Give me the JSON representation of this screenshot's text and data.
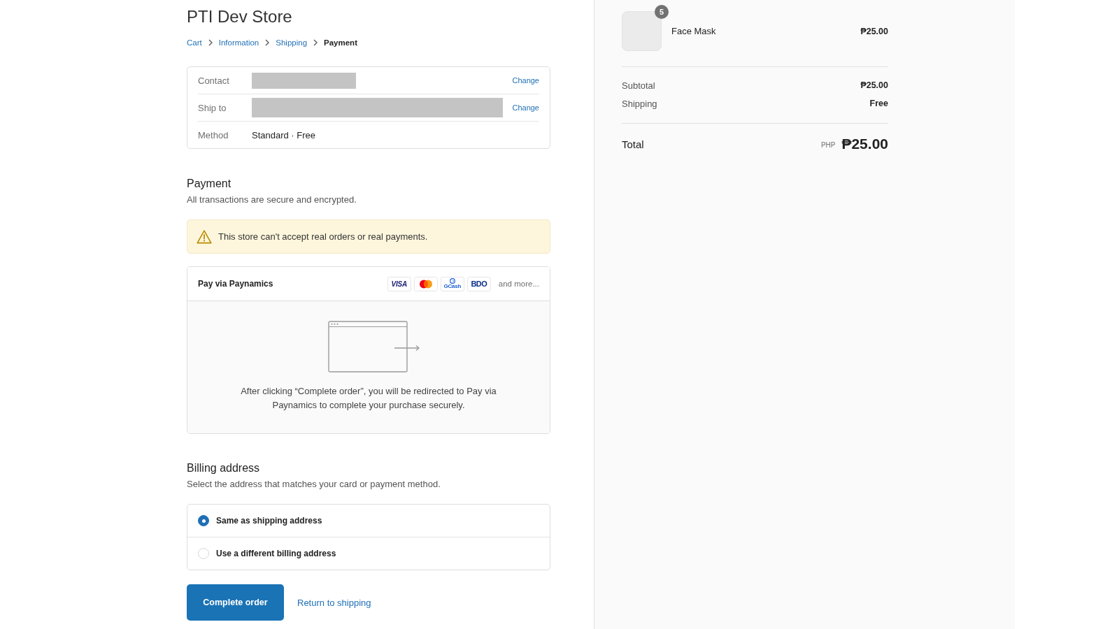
{
  "store": {
    "title": "PTI Dev Store"
  },
  "breadcrumb": [
    {
      "label": "Cart",
      "selected": false
    },
    {
      "label": "Information",
      "selected": false
    },
    {
      "label": "Shipping",
      "selected": false
    },
    {
      "label": "Payment",
      "selected": true
    }
  ],
  "review": [
    {
      "label": "Contact",
      "kind": "redacted",
      "action": "Change"
    },
    {
      "label": "Ship to",
      "kind": "redacted",
      "action": "Change"
    },
    {
      "label": "Method",
      "kind": "text",
      "value": "Standard · Free"
    }
  ],
  "payment": {
    "title": "Payment",
    "subtitle": "All transactions are secure and encrypted.",
    "warning": "This store can't accept real orders or real payments.",
    "method": {
      "title": "Pay via Paynamics",
      "logos": [
        {
          "kind": "visa",
          "text": "VISA"
        },
        {
          "kind": "mastercard"
        },
        {
          "kind": "gcash",
          "text": "GCash"
        },
        {
          "kind": "bdo",
          "text": "BDO"
        }
      ],
      "more": "and more...",
      "note": "After clicking “Complete order”, you will be redirected to Pay via Paynamics to complete your purchase securely."
    }
  },
  "billing": {
    "title": "Billing address",
    "subtitle": "Select the address that matches your card or payment method.",
    "options": [
      {
        "label": "Same as shipping address",
        "selected": true
      },
      {
        "label": "Use a different billing address",
        "selected": false
      }
    ]
  },
  "actions": {
    "primary": "Complete order",
    "secondary": "Return to shipping"
  },
  "summary": {
    "items": [
      {
        "name": "Face Mask",
        "quantity": "5",
        "price": "₱25.00"
      }
    ],
    "lines": [
      {
        "label": "Subtotal",
        "value": "₱25.00"
      },
      {
        "label": "Shipping",
        "value": "Free"
      }
    ],
    "total": {
      "label": "Total",
      "currency": "PHP",
      "value": "₱25.00"
    }
  }
}
